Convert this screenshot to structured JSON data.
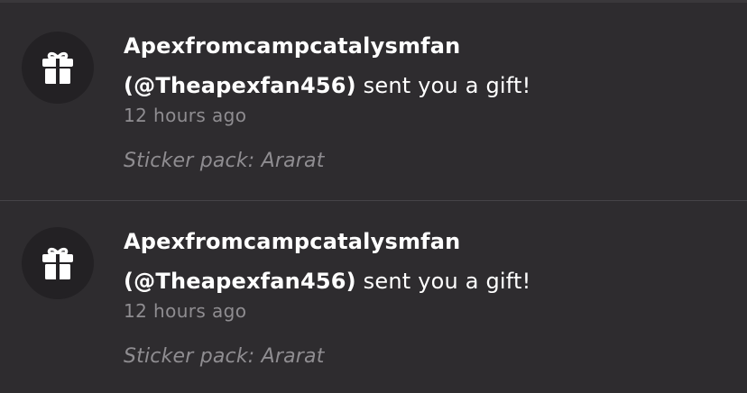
{
  "notifications": [
    {
      "icon": "gift-icon",
      "sender_name": "Apexfromcampcatalysmfan",
      "sender_handle": "(@Theapexfan456)",
      "action_text": "sent you a gift!",
      "timestamp": "12 hours ago",
      "detail": "Sticker pack: Ararat"
    },
    {
      "icon": "gift-icon",
      "sender_name": "Apexfromcampcatalysmfan",
      "sender_handle": "(@Theapexfan456)",
      "action_text": "sent you a gift!",
      "timestamp": "12 hours ago",
      "detail": "Sticker pack: Ararat"
    }
  ],
  "colors": {
    "background": "#2e2c2f",
    "avatar_background": "#232124",
    "primary_text": "#ffffff",
    "secondary_text": "#8f8d91",
    "divider": "#454347"
  }
}
